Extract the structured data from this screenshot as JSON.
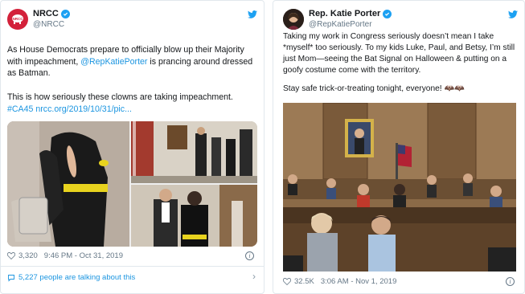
{
  "left_tweet": {
    "display_name": "NRCC",
    "handle": "@NRCC",
    "avatar_text": "NRCC",
    "body_part1": "As House Democrats prepare to officially blow up their Majority with impeachment, ",
    "mention": "@RepKatiePorter",
    "body_part2": " is prancing around dressed as Batman.",
    "body_line2": "This is how seriously these clowns are taking impeachment.",
    "hashtag": "#CA45",
    "link": "nrcc.org/2019/10/31/pic...",
    "likes": "3,320",
    "timestamp": "9:46 PM - Oct 31, 2019",
    "talking": "5,227 people are talking about this"
  },
  "right_tweet": {
    "display_name": "Rep. Katie Porter",
    "handle": "@RepKatiePorter",
    "body": "Taking my work in Congress seriously doesn’t mean I take *myself* too seriously. To my kids Luke, Paul, and Betsy, I’m still just Mom—seeing the Bat Signal on Halloween & putting on a goofy costume come with the territory.",
    "body_line2": "Stay safe trick-or-treating tonight, everyone! 🦇🦇",
    "likes": "32.5K",
    "timestamp": "3:06 AM - Nov 1, 2019"
  },
  "icons": [
    "verified-icon",
    "twitter-bird-icon",
    "heart-icon",
    "info-icon",
    "chevron-right-icon",
    "speech-bubble-icon"
  ],
  "colors": {
    "link": "#1b95e0",
    "verified": "#1da1f2",
    "nrcc_red": "#d3213a",
    "muted": "#657786"
  }
}
